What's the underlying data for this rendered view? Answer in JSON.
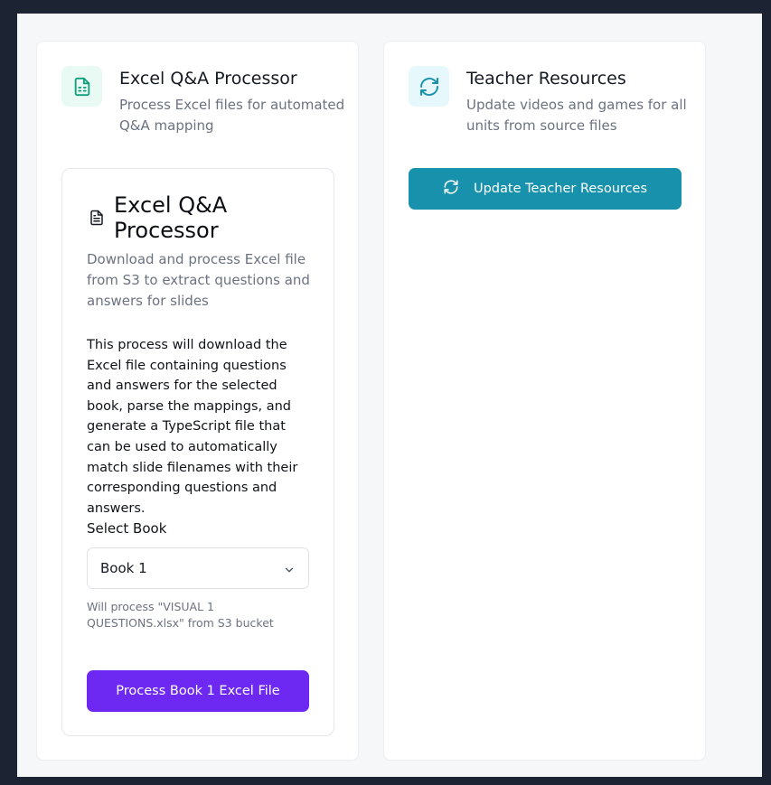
{
  "colors": {
    "outer_background": "#1c2333",
    "page_background": "#f6f7f9",
    "card_background": "#ffffff",
    "green_accent": "#0f9f7a",
    "teal_accent": "#1891ad",
    "purple_button": "#6d28f2"
  },
  "excel_card": {
    "icon": "spreadsheet-file-icon",
    "title": "Excel Q&A Processor",
    "description": "Process Excel files for automated Q&A mapping",
    "panel": {
      "icon": "file-text-icon",
      "title": "Excel Q&A Processor",
      "description": "Download and process Excel file from S3 to extract questions and answers for slides",
      "body": "This process will download the Excel file containing questions and answers for the selected book, parse the mappings, and generate a TypeScript file that can be used to automatically match slide filenames with their corresponding questions and answers.",
      "select_label": "Select Book",
      "select_value": "Book 1",
      "select_icon": "chevron-down-icon",
      "hint": "Will process \"VISUAL 1 QUESTIONS.xlsx\" from S3 bucket",
      "button_label": "Process Book 1 Excel File"
    }
  },
  "teacher_card": {
    "icon": "refresh-icon",
    "title": "Teacher Resources",
    "description": "Update videos and games for all units from source files",
    "button_icon": "refresh-icon",
    "button_label": "Update Teacher Resources"
  }
}
